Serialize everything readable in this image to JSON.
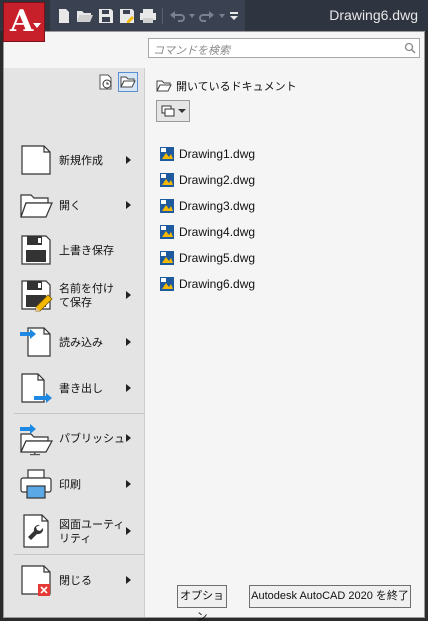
{
  "window": {
    "title": "Drawing6.dwg"
  },
  "app_button": {
    "letter": "A"
  },
  "quick_access": [
    "new-icon",
    "open-icon",
    "save-icon",
    "save-as-icon",
    "plot-icon",
    "undo-icon",
    "redo-icon",
    "customize-icon"
  ],
  "search": {
    "placeholder": "コマンドを検索"
  },
  "menu": {
    "items": [
      {
        "label": "新規作成",
        "has_submenu": true
      },
      {
        "label": "開く",
        "has_submenu": true
      },
      {
        "label": "上書き保存",
        "has_submenu": false
      },
      {
        "label_line1": "名前を付け",
        "label_line2": "て保存",
        "has_submenu": true
      },
      {
        "label": "読み込み",
        "has_submenu": true
      },
      {
        "label": "書き出し",
        "has_submenu": true
      },
      {
        "label": "パブリッシュ",
        "has_submenu": true
      },
      {
        "label": "印刷",
        "has_submenu": true
      },
      {
        "label_line1": "図面ユーティ",
        "label_line2": "リティ",
        "has_submenu": true
      },
      {
        "label": "閉じる",
        "has_submenu": true
      }
    ]
  },
  "open_documents": {
    "heading": "開いているドキュメント",
    "files": [
      "Drawing1.dwg",
      "Drawing2.dwg",
      "Drawing3.dwg",
      "Drawing4.dwg",
      "Drawing5.dwg",
      "Drawing6.dwg"
    ]
  },
  "footer": {
    "options_label": "オプション",
    "exit_label": "Autodesk AutoCAD 2020 を終了"
  },
  "colors": {
    "accent": "#c8202b",
    "arrow_blue": "#1e88e5",
    "close_red": "#e53935",
    "titlebar": "#2e3440"
  }
}
